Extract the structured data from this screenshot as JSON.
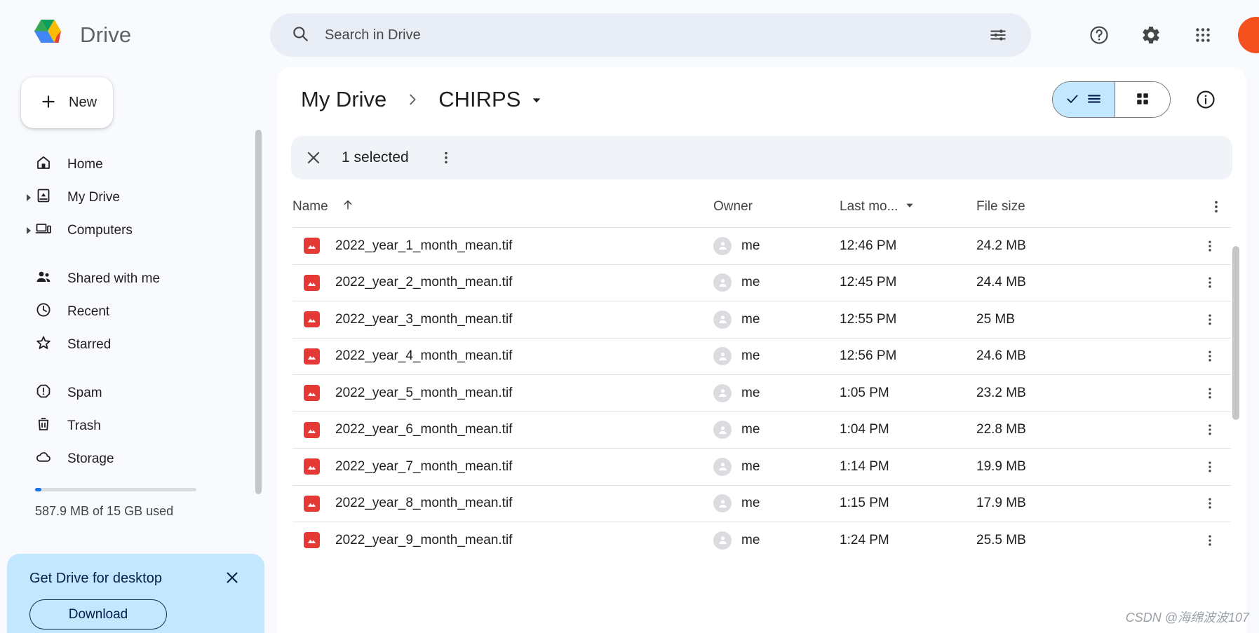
{
  "brand": {
    "name": "Drive",
    "logo_icon": "drive-logo-icon"
  },
  "search": {
    "placeholder": "Search in Drive",
    "value": "",
    "search_icon": "search-icon",
    "tune_icon": "tune-icon"
  },
  "header_actions": {
    "help_icon": "help-icon",
    "settings_icon": "gear-icon",
    "apps_icon": "apps-grid-icon",
    "avatar_label": ""
  },
  "sidebar": {
    "new_button": {
      "label": "New",
      "icon": "plus-icon"
    },
    "items": [
      {
        "label": "Home",
        "icon": "home-icon",
        "expandable": false
      },
      {
        "label": "My Drive",
        "icon": "my-drive-icon",
        "expandable": true
      },
      {
        "label": "Computers",
        "icon": "computers-icon",
        "expandable": true
      },
      {
        "label": "Shared with me",
        "icon": "people-icon",
        "expandable": false
      },
      {
        "label": "Recent",
        "icon": "clock-icon",
        "expandable": false
      },
      {
        "label": "Starred",
        "icon": "star-icon",
        "expandable": false
      },
      {
        "label": "Spam",
        "icon": "spam-icon",
        "expandable": false
      },
      {
        "label": "Trash",
        "icon": "trash-icon",
        "expandable": false
      },
      {
        "label": "Storage",
        "icon": "cloud-icon",
        "expandable": false
      }
    ],
    "storage": {
      "text": "587.9 MB of 15 GB used",
      "percent": 3.9,
      "bar_color": "#1a73e8"
    }
  },
  "promo": {
    "title": "Get Drive for desktop",
    "button_label": "Download",
    "close_icon": "close-icon",
    "background": "#c2e7ff"
  },
  "breadcrumb": {
    "root": "My Drive",
    "separator_icon": "chevron-right-icon",
    "current": "CHIRPS",
    "current_caret_icon": "chevron-down-icon"
  },
  "view_toggle": {
    "list_label": "",
    "list_icon": "list-view-icon",
    "check_icon": "check-icon",
    "grid_icon": "grid-view-icon",
    "active": "list",
    "active_background": "#c2e7ff"
  },
  "info_button": {
    "icon": "info-icon"
  },
  "selection_bar": {
    "close_icon": "close-icon",
    "text": "1 selected",
    "more_icon": "more-vertical-icon"
  },
  "table": {
    "columns": {
      "name": "Name",
      "name_sort_icon": "arrow-up-icon",
      "owner": "Owner",
      "modified": "Last mo...",
      "modified_sort_icon": "caret-down-icon",
      "size": "File size",
      "more_icon": "more-vertical-icon"
    },
    "rows": [
      {
        "name": "2022_year_1_month_mean.tif",
        "owner": "me",
        "modified": "12:46 PM",
        "size": "24.2 MB",
        "icon": "image-file-icon"
      },
      {
        "name": "2022_year_2_month_mean.tif",
        "owner": "me",
        "modified": "12:45 PM",
        "size": "24.4 MB",
        "icon": "image-file-icon"
      },
      {
        "name": "2022_year_3_month_mean.tif",
        "owner": "me",
        "modified": "12:55 PM",
        "size": "25 MB",
        "icon": "image-file-icon"
      },
      {
        "name": "2022_year_4_month_mean.tif",
        "owner": "me",
        "modified": "12:56 PM",
        "size": "24.6 MB",
        "icon": "image-file-icon"
      },
      {
        "name": "2022_year_5_month_mean.tif",
        "owner": "me",
        "modified": "1:05 PM",
        "size": "23.2 MB",
        "icon": "image-file-icon"
      },
      {
        "name": "2022_year_6_month_mean.tif",
        "owner": "me",
        "modified": "1:04 PM",
        "size": "22.8 MB",
        "icon": "image-file-icon"
      },
      {
        "name": "2022_year_7_month_mean.tif",
        "owner": "me",
        "modified": "1:14 PM",
        "size": "19.9 MB",
        "icon": "image-file-icon"
      },
      {
        "name": "2022_year_8_month_mean.tif",
        "owner": "me",
        "modified": "1:15 PM",
        "size": "17.9 MB",
        "icon": "image-file-icon"
      },
      {
        "name": "2022_year_9_month_mean.tif",
        "owner": "me",
        "modified": "1:24 PM",
        "size": "25.5 MB",
        "icon": "image-file-icon"
      }
    ]
  },
  "watermark": {
    "text": "CSDN @海绵波波107"
  }
}
